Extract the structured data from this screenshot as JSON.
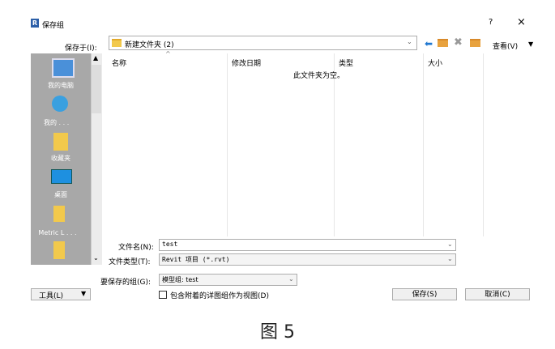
{
  "window": {
    "app_icon_letter": "R",
    "title": "保存组",
    "help": "?",
    "close": "×"
  },
  "toolbar": {
    "save_in_label": "保存于(I):",
    "path": "新建文件夹 (2)",
    "dropdown_glyph": "⌄",
    "back_glyph": "⬅",
    "delete_glyph": "✖",
    "views_label": "查看(V)",
    "views_dd": "▼"
  },
  "places": {
    "items": [
      {
        "label": "我的电脑",
        "icon": "computer-icon"
      },
      {
        "label": "我的 . . .",
        "icon": "documents-icon"
      },
      {
        "label": "收藏夹",
        "icon": "favorites-icon"
      },
      {
        "label": "桌面",
        "icon": "desktop-icon"
      },
      {
        "label": "Metric L . . .",
        "icon": "folder-icon"
      }
    ],
    "scroll_up": "▲",
    "scroll_down": "⌄"
  },
  "filelist": {
    "columns": [
      "名称",
      "修改日期",
      "类型",
      "大小"
    ],
    "sort_glyph": "^",
    "empty_message": "此文件夹为空。"
  },
  "fields": {
    "filename_label": "文件名(N):",
    "filename_value": "test",
    "filetype_label": "文件类型(T):",
    "filetype_value": "Revit 项目 (*.rvt)",
    "group_label": "要保存的组(G):",
    "group_value": "模型组: test"
  },
  "bottom": {
    "tools_label": "工具(L)",
    "tools_dd": "▼",
    "checkbox_label": "包含附着的详图组作为视图(D)",
    "save_label": "保存(S)",
    "cancel_label": "取消(C)"
  },
  "caption": "图 5"
}
